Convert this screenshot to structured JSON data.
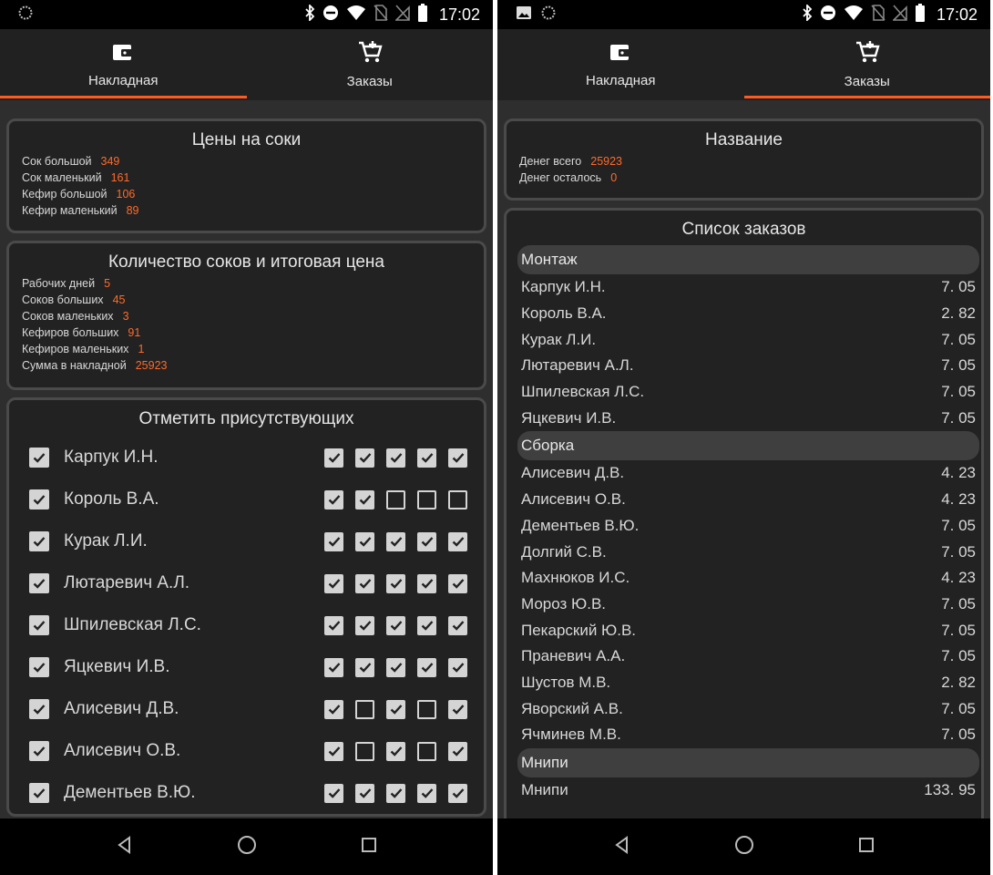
{
  "status_bar": {
    "time": "17:02"
  },
  "tabs": [
    {
      "label": "Накладная",
      "icon": "wallet-icon"
    },
    {
      "label": "Заказы",
      "icon": "cart-add-icon"
    }
  ],
  "left": {
    "prices_card": {
      "title": "Цены на соки",
      "rows": [
        {
          "label": "Сок большой",
          "value": "349"
        },
        {
          "label": "Сок маленький",
          "value": "161"
        },
        {
          "label": "Кефир большой",
          "value": "106"
        },
        {
          "label": "Кефир маленький",
          "value": "89"
        }
      ]
    },
    "totals_card": {
      "title": "Количество соков и итоговая цена",
      "rows": [
        {
          "label": "Рабочих дней",
          "value": "5"
        },
        {
          "label": "Соков больших",
          "value": "45"
        },
        {
          "label": "Соков маленьких",
          "value": "3"
        },
        {
          "label": "Кефиров больших",
          "value": "91"
        },
        {
          "label": "Кефиров маленьких",
          "value": "1"
        },
        {
          "label": "Сумма в накладной",
          "value": "25923"
        }
      ]
    },
    "attendance_card": {
      "title": "Отметить присутствующих",
      "people": [
        {
          "name": "Карпук И.Н.",
          "present": true,
          "days": [
            true,
            true,
            true,
            true,
            true
          ]
        },
        {
          "name": "Король В.А.",
          "present": true,
          "days": [
            true,
            true,
            false,
            false,
            false
          ]
        },
        {
          "name": "Курак Л.И.",
          "present": true,
          "days": [
            true,
            true,
            true,
            true,
            true
          ]
        },
        {
          "name": "Лютаревич А.Л.",
          "present": true,
          "days": [
            true,
            true,
            true,
            true,
            true
          ]
        },
        {
          "name": "Шпилевская Л.С.",
          "present": true,
          "days": [
            true,
            true,
            true,
            true,
            true
          ]
        },
        {
          "name": "Яцкевич И.В.",
          "present": true,
          "days": [
            true,
            true,
            true,
            true,
            true
          ]
        },
        {
          "name": "Алисевич Д.В.",
          "present": true,
          "days": [
            true,
            false,
            true,
            false,
            true
          ]
        },
        {
          "name": "Алисевич О.В.",
          "present": true,
          "days": [
            true,
            false,
            true,
            false,
            true
          ]
        },
        {
          "name": "Дементьев В.Ю.",
          "present": true,
          "days": [
            true,
            true,
            true,
            true,
            true
          ]
        }
      ]
    }
  },
  "right": {
    "summary_card": {
      "title": "Название",
      "rows": [
        {
          "label": "Денег всего",
          "value": "25923"
        },
        {
          "label": "Денег осталось",
          "value": "0"
        }
      ]
    },
    "orders_card": {
      "title": "Список заказов",
      "sections": [
        {
          "header": "Монтаж",
          "items": [
            {
              "name": "Карпук И.Н.",
              "amount": "7. 05"
            },
            {
              "name": "Король В.А.",
              "amount": "2. 82"
            },
            {
              "name": "Курак Л.И.",
              "amount": "7. 05"
            },
            {
              "name": "Лютаревич А.Л.",
              "amount": "7. 05"
            },
            {
              "name": "Шпилевская Л.С.",
              "amount": "7. 05"
            },
            {
              "name": "Яцкевич И.В.",
              "amount": "7. 05"
            }
          ]
        },
        {
          "header": "Сборка",
          "items": [
            {
              "name": "Алисевич Д.В.",
              "amount": "4. 23"
            },
            {
              "name": "Алисевич О.В.",
              "amount": "4. 23"
            },
            {
              "name": "Дементьев В.Ю.",
              "amount": "7. 05"
            },
            {
              "name": "Долгий С.В.",
              "amount": "7. 05"
            },
            {
              "name": "Махнюков И.С.",
              "amount": "4. 23"
            },
            {
              "name": "Мороз Ю.В.",
              "amount": "7. 05"
            },
            {
              "name": "Пекарский Ю.В.",
              "amount": "7. 05"
            },
            {
              "name": "Праневич А.А.",
              "amount": "7. 05"
            },
            {
              "name": "Шустов М.В.",
              "amount": "2. 82"
            },
            {
              "name": "Яворский А.В.",
              "amount": "7. 05"
            },
            {
              "name": "Ячминев М.В.",
              "amount": "7. 05"
            }
          ]
        },
        {
          "header": "Мнипи",
          "items": [
            {
              "name": "Мнипи",
              "amount": "133. 95"
            }
          ]
        }
      ]
    }
  },
  "accent_color": "#ff5a1f",
  "value_color": "#ff6a2a"
}
